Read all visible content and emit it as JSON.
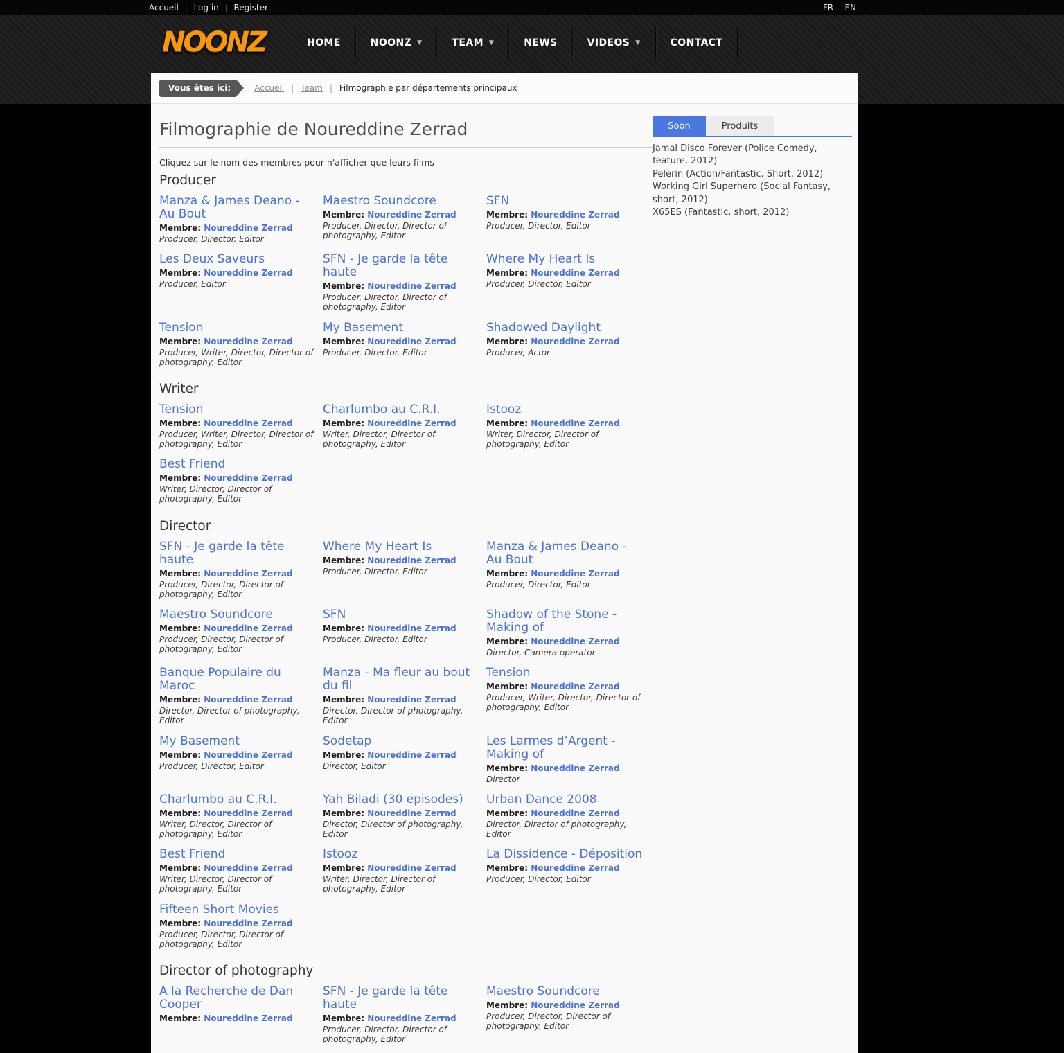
{
  "topbar": {
    "links": [
      "Accueil",
      "Log in",
      "Register"
    ],
    "lang": {
      "fr": "FR",
      "sep": "-",
      "en": "EN"
    }
  },
  "header": {
    "logo_text": "NOONZ",
    "nav": [
      {
        "label": "HOME",
        "dropdown": false
      },
      {
        "label": "NOONZ",
        "dropdown": true
      },
      {
        "label": "TEAM",
        "dropdown": true
      },
      {
        "label": "NEWS",
        "dropdown": false
      },
      {
        "label": "VIDEOS",
        "dropdown": true
      },
      {
        "label": "CONTACT",
        "dropdown": false
      }
    ]
  },
  "breadcrumb": {
    "badge": "Vous êtes ici:",
    "links": [
      "Accueil",
      "Team"
    ],
    "current": "Filmographie par départements principaux"
  },
  "main": {
    "title": "Filmographie de Noureddine Zerrad",
    "note": "Cliquez sur le nom des membres pour n'afficher que leurs films",
    "member_label": "Membre:",
    "member_name": "Noureddine Zerrad",
    "sections": [
      {
        "heading": "Producer",
        "films": [
          {
            "title": "Manza & James Deano - Au Bout",
            "roles": "Producer, Director, Editor"
          },
          {
            "title": "Maestro Soundcore",
            "roles": "Producer, Director, Director of photography, Editor"
          },
          {
            "title": "SFN",
            "roles": "Producer, Director, Editor"
          },
          {
            "title": "Les Deux Saveurs",
            "roles": "Producer, Editor"
          },
          {
            "title": "SFN - Je garde la tête haute",
            "roles": "Producer, Director, Director of photography, Editor"
          },
          {
            "title": "Where My Heart Is",
            "roles": "Producer, Director, Editor"
          },
          {
            "title": "Tension",
            "roles": "Producer, Writer, Director, Director of photography, Editor"
          },
          {
            "title": "My Basement",
            "roles": "Producer, Director, Editor"
          },
          {
            "title": "Shadowed Daylight",
            "roles": "Producer, Actor"
          }
        ]
      },
      {
        "heading": "Writer",
        "films": [
          {
            "title": "Tension",
            "roles": "Producer, Writer, Director, Director of photography, Editor"
          },
          {
            "title": "Charlumbo au C.R.I.",
            "roles": "Writer, Director, Director of photography, Editor"
          },
          {
            "title": "Istooz",
            "roles": "Writer, Director, Director of photography, Editor"
          },
          {
            "title": "Best Friend",
            "roles": "Writer, Director, Director of photography, Editor"
          }
        ]
      },
      {
        "heading": "Director",
        "films": [
          {
            "title": "SFN - Je garde la tête haute",
            "roles": "Producer, Director, Director of photography, Editor"
          },
          {
            "title": "Where My Heart Is",
            "roles": "Producer, Director, Editor"
          },
          {
            "title": "Manza & James Deano - Au Bout",
            "roles": "Producer, Director, Editor"
          },
          {
            "title": "Maestro Soundcore",
            "roles": "Producer, Director, Director of photography, Editor"
          },
          {
            "title": "SFN",
            "roles": "Producer, Director, Editor"
          },
          {
            "title": "Shadow of the Stone - Making of",
            "roles": "Director, Camera operator"
          },
          {
            "title": "Banque Populaire du Maroc",
            "roles": "Director, Director of photography, Editor"
          },
          {
            "title": "Manza - Ma fleur au bout du fil",
            "roles": "Director, Director of photography, Editor"
          },
          {
            "title": "Tension",
            "roles": "Producer, Writer, Director, Director of photography, Editor"
          },
          {
            "title": "My Basement",
            "roles": "Producer, Director, Editor"
          },
          {
            "title": "Sodetap",
            "roles": "Director, Editor"
          },
          {
            "title": "Les Larmes d’Argent - Making of",
            "roles": "Director"
          },
          {
            "title": "Charlumbo au C.R.I.",
            "roles": "Writer, Director, Director of photography, Editor"
          },
          {
            "title": "Yah Biladi (30 episodes)",
            "roles": "Director, Director of photography, Editor"
          },
          {
            "title": "Urban Dance 2008",
            "roles": "Director, Director of photography, Editor"
          },
          {
            "title": "Best Friend",
            "roles": "Writer, Director, Director of photography, Editor"
          },
          {
            "title": "Istooz",
            "roles": "Writer, Director, Director of photography, Editor"
          },
          {
            "title": "La Dissidence - Déposition",
            "roles": "Producer, Director, Editor"
          },
          {
            "title": "Fifteen Short Movies",
            "roles": "Producer, Director, Director of photography, Editor"
          }
        ]
      },
      {
        "heading": "Director of photography",
        "films": [
          {
            "title": "A la Recherche de Dan Cooper",
            "roles": ""
          },
          {
            "title": "SFN - Je garde la tête haute",
            "roles": "Producer, Director, Director of photography, Editor"
          },
          {
            "title": "Maestro Soundcore",
            "roles": "Producer, Director, Director of photography, Editor"
          }
        ]
      }
    ]
  },
  "sidebar": {
    "tabs": [
      {
        "label": "Soon",
        "active": true
      },
      {
        "label": "Produits",
        "active": false
      }
    ],
    "items": [
      "Jamal Disco Forever (Police Comedy, feature, 2012)",
      "Pelerin (Action/Fantastic, Short, 2012)",
      "Working Girl Superhero (Social Fantasy, short, 2012)",
      "X65ES (Fantastic, short, 2012)"
    ]
  },
  "colors": {
    "accent_blue": "#4a70d9",
    "tab_blue": "#4a77e0",
    "logo_orange": "#f6980f"
  }
}
